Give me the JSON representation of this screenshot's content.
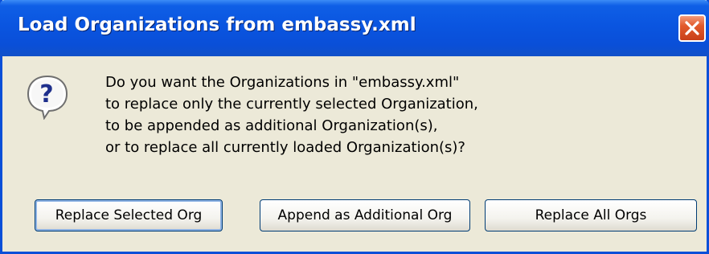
{
  "dialog": {
    "title": "Load Organizations from embassy.xml",
    "message_lines": [
      "Do you want the Organizations in \"embassy.xml\"",
      "to replace only the currently selected Organization,",
      "to be appended as additional Organization(s),",
      "or to replace all currently loaded Organization(s)?"
    ],
    "icon": "question-icon",
    "buttons": {
      "replace_selected": "Replace Selected Org",
      "append": "Append as Additional Org",
      "replace_all": "Replace All Orgs"
    }
  },
  "colors": {
    "titlebar": "#0a4fd8",
    "dialog_bg": "#ece9d8",
    "close_button": "#e25a2c",
    "button_border": "#003c74"
  }
}
